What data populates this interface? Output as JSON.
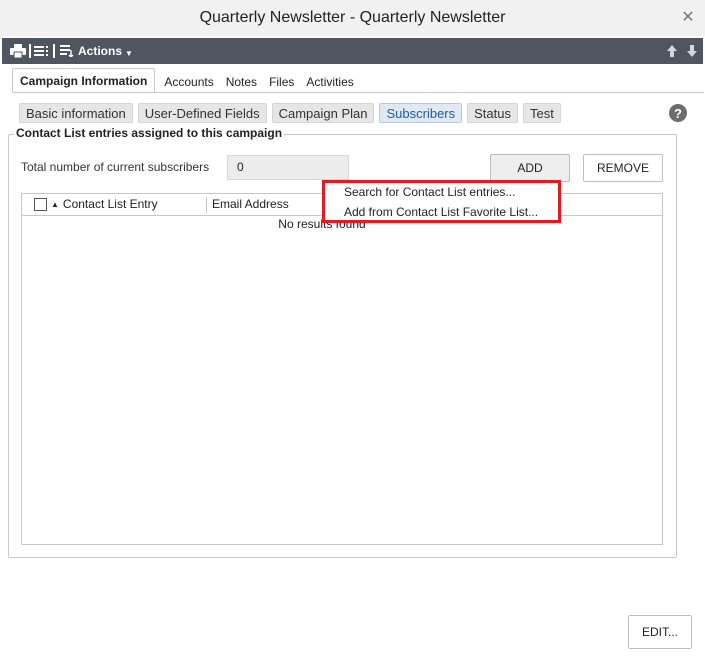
{
  "window": {
    "title": "Quarterly Newsletter - Quarterly Newsletter"
  },
  "toolbar": {
    "actions_label": "Actions"
  },
  "tabs": [
    "Campaign Information",
    "Accounts",
    "Notes",
    "Files",
    "Activities"
  ],
  "subtabs": [
    "Basic information",
    "User-Defined Fields",
    "Campaign Plan",
    "Subscribers",
    "Status",
    "Test"
  ],
  "section": {
    "title": "Contact List entries assigned to this campaign",
    "total_label": "Total number of current subscribers",
    "total_value": "0",
    "add_label": "ADD",
    "remove_label": "REMOVE"
  },
  "grid": {
    "columns": [
      "Contact List Entry",
      "Email Address"
    ],
    "empty_text": "No results found"
  },
  "add_menu": {
    "items": [
      "Search for Contact List entries...",
      "Add from Contact List Favorite List..."
    ]
  },
  "footer": {
    "edit_label": "EDIT..."
  },
  "colors": {
    "toolbar": "#4f5660",
    "highlight": "#e01b24",
    "active_subtab": "#1d5fa7"
  },
  "icons": [
    "close-icon",
    "print-icon",
    "list-icon",
    "actions-list-icon",
    "arrow-up-icon",
    "arrow-down-icon",
    "help-icon",
    "sort-asc-icon"
  ]
}
